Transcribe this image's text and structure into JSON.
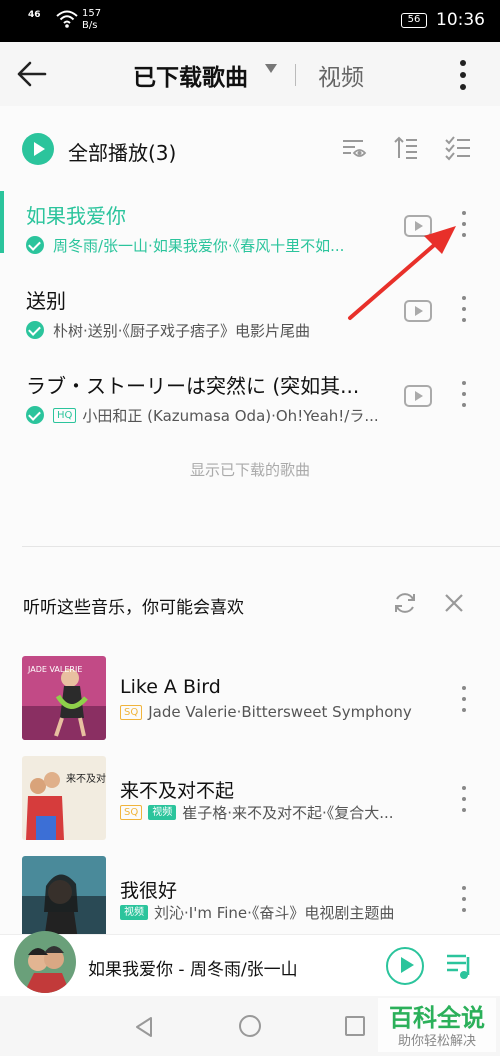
{
  "status_bar": {
    "signal": "46",
    "speed_value": "157",
    "speed_unit": "B/s",
    "battery": "56",
    "time": "10:36"
  },
  "header": {
    "title": "已下载歌曲",
    "video_tab": "视频"
  },
  "play_all": {
    "label": "全部播放(3)"
  },
  "songs": [
    {
      "title": "如果我爱你",
      "subtitle": "周冬雨/张一山·如果我爱你·《春风十里不如...",
      "badge": "",
      "active": true
    },
    {
      "title": "送别",
      "subtitle": "朴树·送别·《厨子戏子痞子》电影片尾曲",
      "badge": "",
      "active": false
    },
    {
      "title": "ラブ・ストーリーは突然に (突如其...",
      "subtitle": "小田和正 (Kazumasa Oda)·Oh!Yeah!/ラ...",
      "badge": "HQ",
      "active": false
    }
  ],
  "hint": "显示已下载的歌曲",
  "recommend": {
    "title": "听听这些音乐，你可能会喜欢",
    "items": [
      {
        "title": "Like A Bird",
        "badges": [
          "SQ"
        ],
        "subtitle": "Jade Valerie·Bittersweet Symphony",
        "cover_text": "JADE VALERIE"
      },
      {
        "title": "来不及对不起",
        "badges": [
          "SQ",
          "视频"
        ],
        "subtitle": "崔子格·来不及对不起·《复合大...",
        "cover_text": "来不及对不起"
      },
      {
        "title": "我很好",
        "badges": [
          "视频"
        ],
        "subtitle": "刘沁·I'm Fine·《奋斗》电视剧主题曲",
        "cover_text": ""
      }
    ]
  },
  "player": {
    "now_playing": "如果我爱你 - 周冬雨/张一山"
  },
  "watermark": {
    "main": "百科全说",
    "sub": "助你轻松解决"
  },
  "colors": {
    "accent": "#2bc49c",
    "arrow": "#e8302a"
  }
}
